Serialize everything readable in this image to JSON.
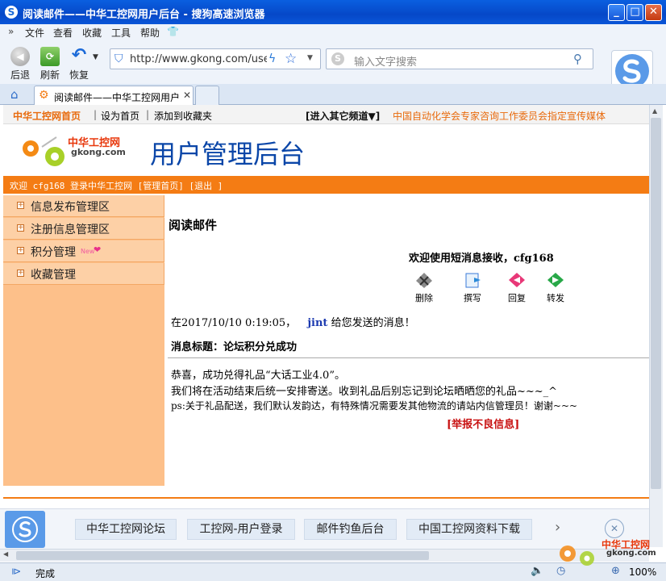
{
  "window": {
    "title": "阅读邮件——中华工控网用户后台 - 搜狗高速浏览器"
  },
  "menu": {
    "chevron": "»",
    "items": [
      "文件",
      "查看",
      "收藏",
      "工具",
      "帮助"
    ]
  },
  "nav": {
    "back": "后退",
    "refresh": "刷新",
    "restore": "恢复"
  },
  "address": {
    "url": "http://www.gkong.com/use"
  },
  "search": {
    "placeholder": "输入文字搜索"
  },
  "tabs": [
    {
      "title": "阅读邮件——中华工控网用户"
    }
  ],
  "site": {
    "toplinks": [
      "中华工控网首页",
      "设为首页",
      "添加到收藏夹"
    ],
    "channel": "[进入其它频道▼]",
    "slogan": "中国自动化学会专家咨询工作委员会指定宣传媒体",
    "logo_cn": "中华工控网",
    "logo_en": "gkong.com",
    "header_title": "用户管理后台",
    "welcome": "欢迎 cfg168 登录中华工控网 [管理首页] [退出 ]"
  },
  "sidebar": {
    "items": [
      "信息发布管理区",
      "注册信息管理区",
      "积分管理",
      "收藏管理"
    ],
    "new_badge": "New"
  },
  "mail": {
    "heading": "阅读邮件",
    "greeting": "欢迎使用短消息接收，cfg168",
    "actions": [
      "删除",
      "撰写",
      "回复",
      "转发"
    ],
    "sent_prefix": "在2017/10/10 0:19:05，",
    "sender": "jint",
    "sent_suffix": "给您发送的消息！",
    "subject_label": "消息标题：论坛积分兑成功",
    "body": [
      "恭喜，成功兑得礼品“大话工业4.0”。",
      "我们将在活动结束后统一安排寄送。收到礼品后别忘记到论坛晒晒您的礼品~~~_^",
      "ps:关于礼品配送，我们默认发韵达，有特殊情况需要发其他物流的请站内信管理员！谢谢~~~"
    ],
    "report": "[举报不良信息]"
  },
  "bookmarks": [
    "中华工控网论坛",
    "工控网-用户登录",
    "邮件钓鱼后台",
    "中国工控网资料下载"
  ],
  "status": {
    "text": "完成",
    "zoom": "100%"
  },
  "watermark": {
    "cn": "中华工控网",
    "en": "gkong.com"
  },
  "colors": {
    "orange": "#f47c14",
    "brand_blue": "#0648c8",
    "title_blue": "#0a46a8"
  }
}
